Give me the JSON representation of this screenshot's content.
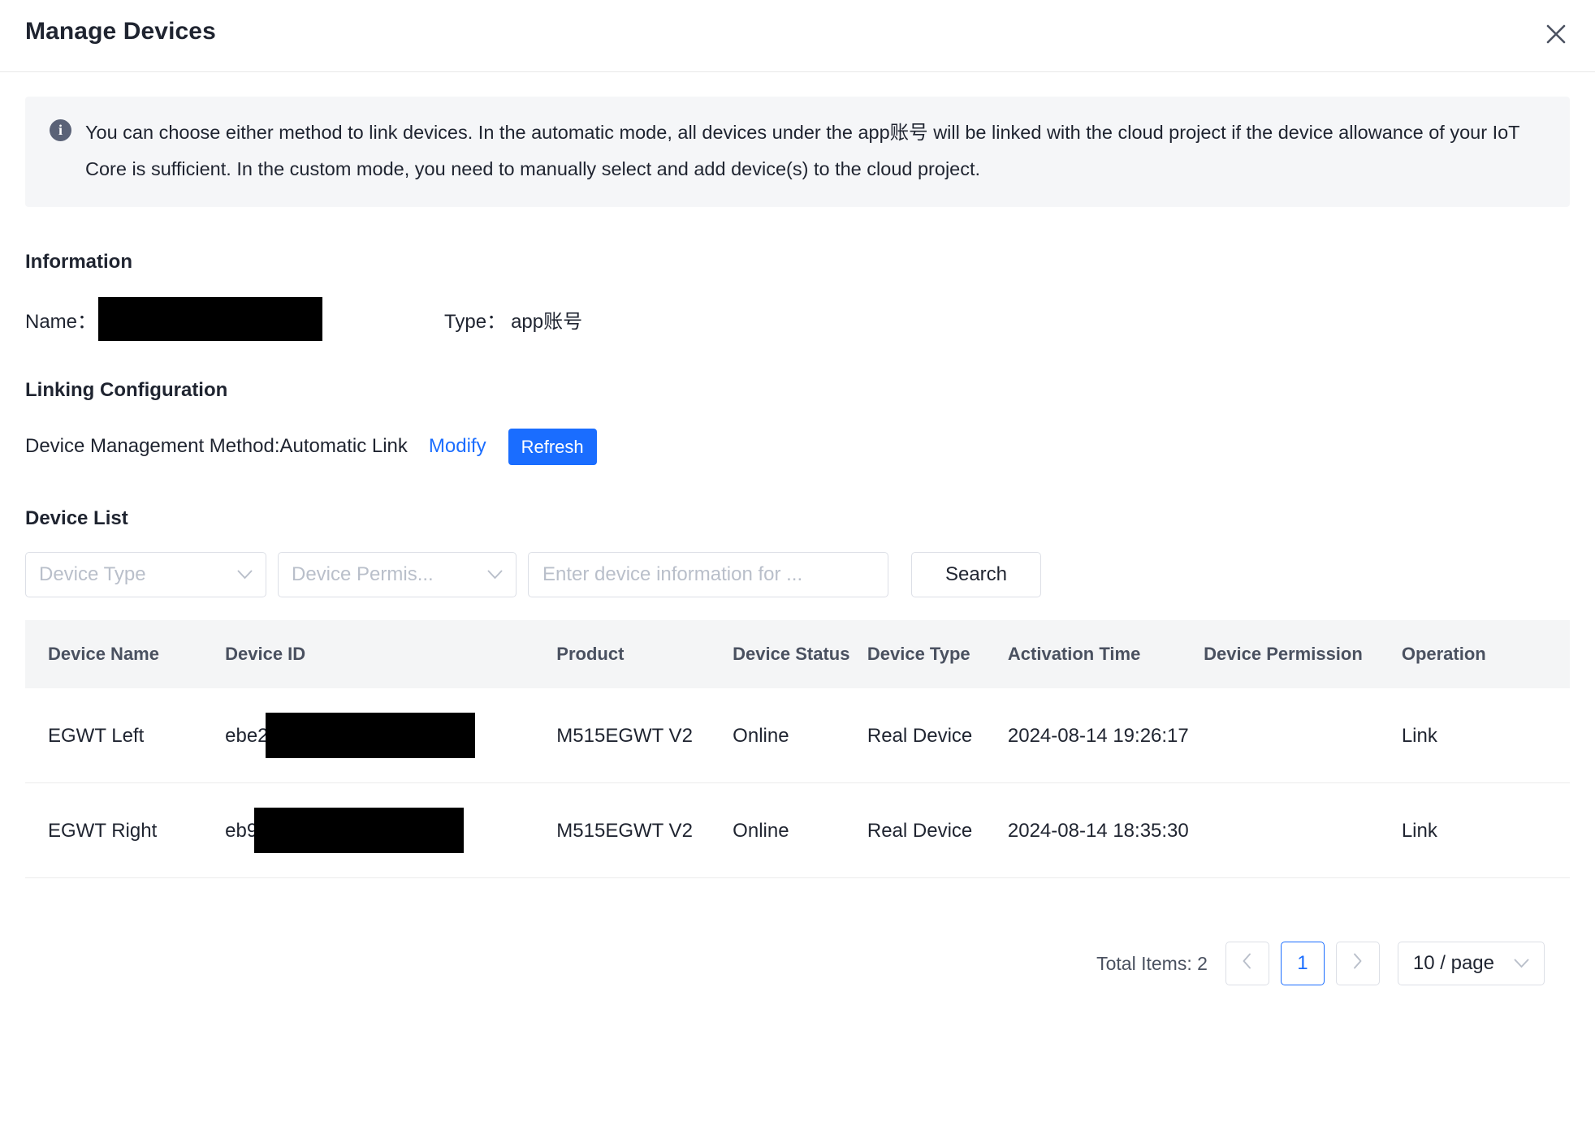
{
  "dialog": {
    "title": "Manage Devices",
    "close_icon": "close-icon"
  },
  "banner": {
    "icon": "info-icon",
    "text": "You can choose either method to link devices. In the automatic mode, all devices under the app账号 will be linked with the cloud project if the device allowance of your IoT Core is sufficient. In the custom mode, you need to manually select and add device(s) to the cloud project."
  },
  "information": {
    "section_title": "Information",
    "name_label": "Name：",
    "name_value": "",
    "type_label": "Type：",
    "type_value": "app账号"
  },
  "linking": {
    "section_title": "Linking Configuration",
    "method_text": "Device Management Method:Automatic Link",
    "modify_label": "Modify",
    "refresh_label": "Refresh"
  },
  "device_list": {
    "section_title": "Device List",
    "filters": {
      "device_type_placeholder": "Device Type",
      "device_permission_placeholder": "Device Permis...",
      "search_placeholder": "Enter device information for ...",
      "search_button": "Search"
    },
    "columns": [
      "Device Name",
      "Device ID",
      "Product",
      "Device Status",
      "Device Type",
      "Activation Time",
      "Device Permission",
      "Operation"
    ],
    "rows": [
      {
        "device_name": "EGWT Left",
        "device_id_prefix": "ebe2",
        "device_id_redacted": true,
        "product": "M515EGWT V2",
        "device_status": "Online",
        "device_type": "Real Device",
        "activation_time": "2024-08-14 19:26:17",
        "device_permission": "",
        "operation": "Link"
      },
      {
        "device_name": "EGWT Right",
        "device_id_prefix": "eb9",
        "device_id_redacted": true,
        "product": "M515EGWT V2",
        "device_status": "Online",
        "device_type": "Real Device",
        "activation_time": "2024-08-14 18:35:30",
        "device_permission": "",
        "operation": "Link"
      }
    ]
  },
  "pagination": {
    "total_items": "Total Items: 2",
    "prev_icon": "chevron-left-icon",
    "current_page": "1",
    "next_icon": "chevron-right-icon",
    "page_size": "10 / page",
    "page_size_icon": "chevron-down-icon"
  },
  "colors": {
    "accent": "#1a6dff",
    "online": "#28c07c",
    "muted": "#b8bcc4"
  }
}
